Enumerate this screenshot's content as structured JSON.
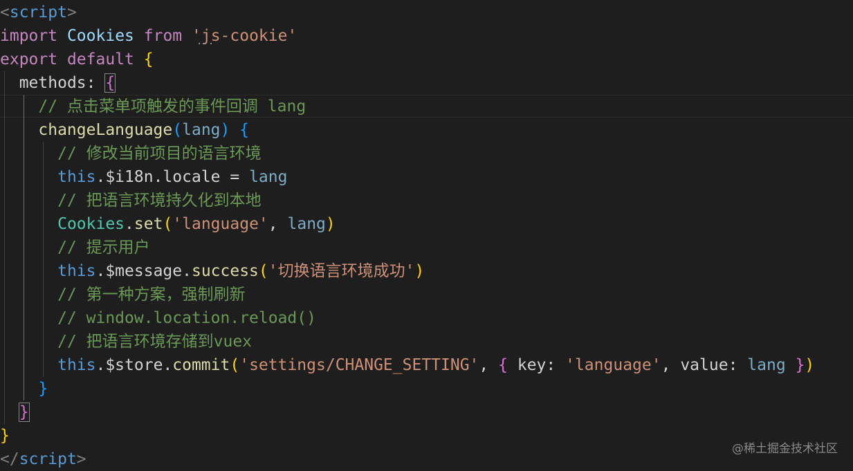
{
  "code": {
    "l1": {
      "open": "<",
      "name": "script",
      "close": ">"
    },
    "l2": {
      "kw": "import",
      "ident": "Cookies",
      "kw2": "from",
      "str": "'js-cookie'"
    },
    "l3": {
      "kw": "export",
      "kw2": "default",
      "brace": "{"
    },
    "l4": {
      "prop": "methods",
      "colon": ":",
      "brace": "{"
    },
    "l5": {
      "comment": "// 点击菜单项触发的事件回调 lang"
    },
    "l6": {
      "fn": "changeLanguage",
      "open": "(",
      "param": "lang",
      "close": ")",
      "brace": "{"
    },
    "l7": {
      "comment": "// 修改当前项目的语言环境"
    },
    "l8": {
      "this": "this",
      "rest": ".$i18n.locale",
      "eq": "=",
      "val": "lang"
    },
    "l9": {
      "comment": "// 把语言环境持久化到本地"
    },
    "l10": {
      "obj": "Cookies",
      "dot": ".",
      "fn": "set",
      "open": "(",
      "str": "'language'",
      "comma": ",",
      "val": "lang",
      "close": ")"
    },
    "l11": {
      "comment": "// 提示用户"
    },
    "l12": {
      "this": "this",
      "rest": ".$message.",
      "fn": "success",
      "open": "(",
      "str": "'切换语言环境成功'",
      "close": ")"
    },
    "l13": {
      "comment": "// 第一种方案，强制刷新"
    },
    "l14": {
      "comment": "// window.location.reload()"
    },
    "l15": {
      "comment": "// 把语言环境存储到vuex"
    },
    "l16": {
      "this": "this",
      "rest": ".$store.",
      "fn": "commit",
      "open": "(",
      "str1": "'settings/CHANGE_SETTING'",
      "comma": ",",
      "brace_open": "{",
      "key1": "key",
      "colon1": ":",
      "str2": "'language'",
      "comma2": ",",
      "key2": "value",
      "colon2": ":",
      "val": "lang",
      "brace_close": "}",
      "close": ")"
    },
    "l17": {
      "brace": "}"
    },
    "l18": {
      "brace": "}"
    },
    "l19": {
      "brace": "}"
    },
    "l20": {
      "open": "</",
      "name": "script",
      "close": ">"
    }
  },
  "watermark": "@稀土掘金技术社区",
  "colors": {
    "background": "#1e1e1e",
    "keyword": "#c586c0",
    "string": "#ce9178",
    "comment": "#6a9955",
    "function": "#dcdcaa",
    "class": "#4ec9b0",
    "variable": "#9cdcfe",
    "tag": "#569cd6"
  }
}
